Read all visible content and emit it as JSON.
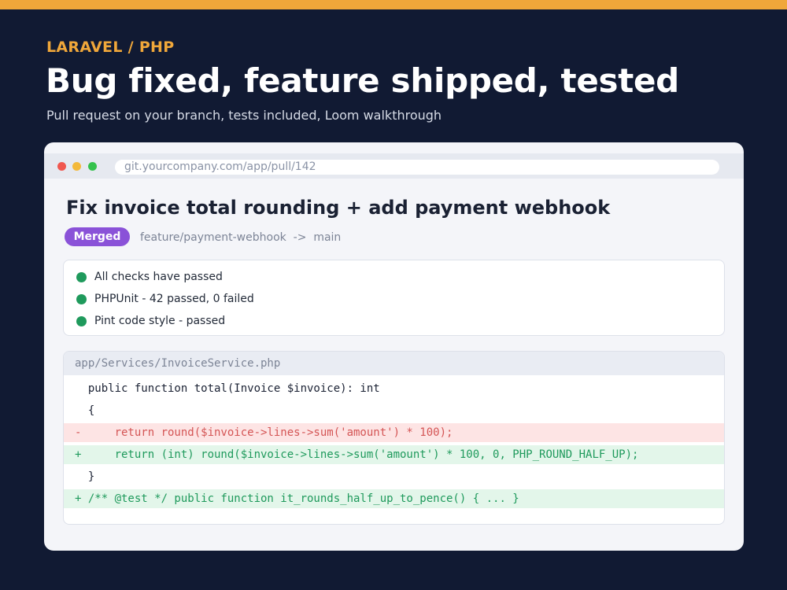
{
  "eyebrow": "LARAVEL / PHP",
  "headline": "Bug fixed, feature shipped, tested",
  "subhead": "Pull request on your branch, tests included, Loom walkthrough",
  "colors": {
    "accent": "#f0a73a",
    "background": "#111a33",
    "merged_badge": "#8a52d8",
    "check_pass": "#1f9a5c",
    "diff_removed": "#d45555",
    "diff_added": "#1f9a5c"
  },
  "browser": {
    "url": "git.yourcompany.com/app/pull/142"
  },
  "pull_request": {
    "title": "Fix invoice total rounding + add payment webhook",
    "status_badge": "Merged",
    "branch_info": "feature/payment-webhook  ->  main"
  },
  "checks": [
    {
      "status": "passed",
      "icon": "check-dot-icon",
      "label": "All checks have passed"
    },
    {
      "status": "passed",
      "icon": "check-dot-icon",
      "label": "PHPUnit - 42 passed, 0 failed"
    },
    {
      "status": "passed",
      "icon": "check-dot-icon",
      "label": "Pint code style - passed"
    }
  ],
  "diff": {
    "file": "app/Services/InvoiceService.php",
    "lines": [
      {
        "type": "context",
        "text": "  public function total(Invoice $invoice): int"
      },
      {
        "type": "context",
        "text": "  {"
      },
      {
        "type": "removed",
        "text": "-     return round($invoice->lines->sum('amount') * 100);"
      },
      {
        "type": "added",
        "text": "+     return (int) round($invoice->lines->sum('amount') * 100, 0, PHP_ROUND_HALF_UP);"
      },
      {
        "type": "context",
        "text": "  }"
      },
      {
        "type": "added",
        "text": "+ /** @test */ public function it_rounds_half_up_to_pence() { ... }"
      }
    ]
  }
}
